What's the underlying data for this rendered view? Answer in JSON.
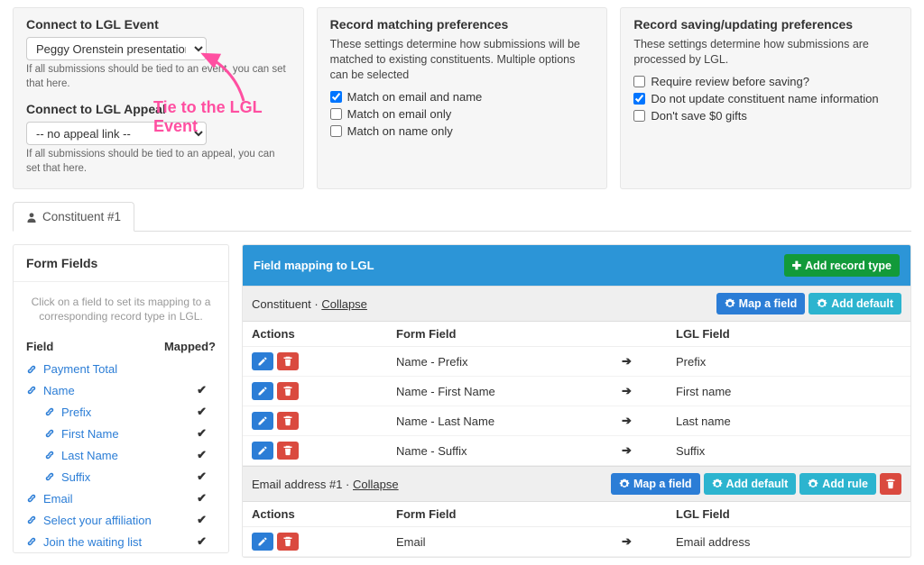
{
  "topLeft": {
    "eventTitle": "Connect to LGL Event",
    "eventSelected": "Peggy Orenstein presentation",
    "eventHint": "If all submissions should be tied to an event, you can set that here.",
    "appealTitle": "Connect to LGL Appeal",
    "appealSelected": "-- no appeal link --",
    "appealHint": "If all submissions should be tied to an appeal, you can set that here.",
    "annotation": "Tie to the LGL Event"
  },
  "matching": {
    "title": "Record matching preferences",
    "desc": "These settings determine how submissions will be matched to existing constituents. Multiple options can be selected",
    "opts": [
      "Match on email and name",
      "Match on email only",
      "Match on name only"
    ],
    "checked": [
      true,
      false,
      false
    ]
  },
  "saving": {
    "title": "Record saving/updating preferences",
    "desc": "These settings determine how submissions are processed by LGL.",
    "opts": [
      "Require review before saving?",
      "Do not update constituent name information",
      "Don't save $0 gifts"
    ],
    "checked": [
      false,
      true,
      false
    ]
  },
  "tab": "Constituent #1",
  "formFields": {
    "title": "Form Fields",
    "instr": "Click on a field to set its mapping to a corresponding record type in LGL.",
    "colField": "Field",
    "colMapped": "Mapped?",
    "items": [
      {
        "label": "Payment Total",
        "mapped": false,
        "indent": 0
      },
      {
        "label": "Name",
        "mapped": true,
        "indent": 0
      },
      {
        "label": "Prefix",
        "mapped": true,
        "indent": 1
      },
      {
        "label": "First Name",
        "mapped": true,
        "indent": 1
      },
      {
        "label": "Last Name",
        "mapped": true,
        "indent": 1
      },
      {
        "label": "Suffix",
        "mapped": true,
        "indent": 1
      },
      {
        "label": "Email",
        "mapped": true,
        "indent": 0
      },
      {
        "label": "Select your affiliation",
        "mapped": true,
        "indent": 0
      },
      {
        "label": "Join the waiting list",
        "mapped": true,
        "indent": 0
      }
    ]
  },
  "mapping": {
    "title": "Field mapping to LGL",
    "addRecord": "Add record type",
    "mapField": "Map a field",
    "addDefault": "Add default",
    "addRule": "Add rule",
    "cols": {
      "actions": "Actions",
      "form": "Form Field",
      "lgl": "LGL Field"
    },
    "collapse": "Collapse",
    "groups": [
      {
        "name": "Constituent",
        "hasRule": false,
        "hasDelete": false,
        "rows": [
          {
            "form": "Name - Prefix",
            "lgl": "Prefix"
          },
          {
            "form": "Name - First Name",
            "lgl": "First name"
          },
          {
            "form": "Name - Last Name",
            "lgl": "Last name"
          },
          {
            "form": "Name - Suffix",
            "lgl": "Suffix"
          }
        ]
      },
      {
        "name": "Email address #1",
        "hasRule": true,
        "hasDelete": true,
        "rows": [
          {
            "form": "Email",
            "lgl": "Email address"
          }
        ]
      }
    ]
  }
}
